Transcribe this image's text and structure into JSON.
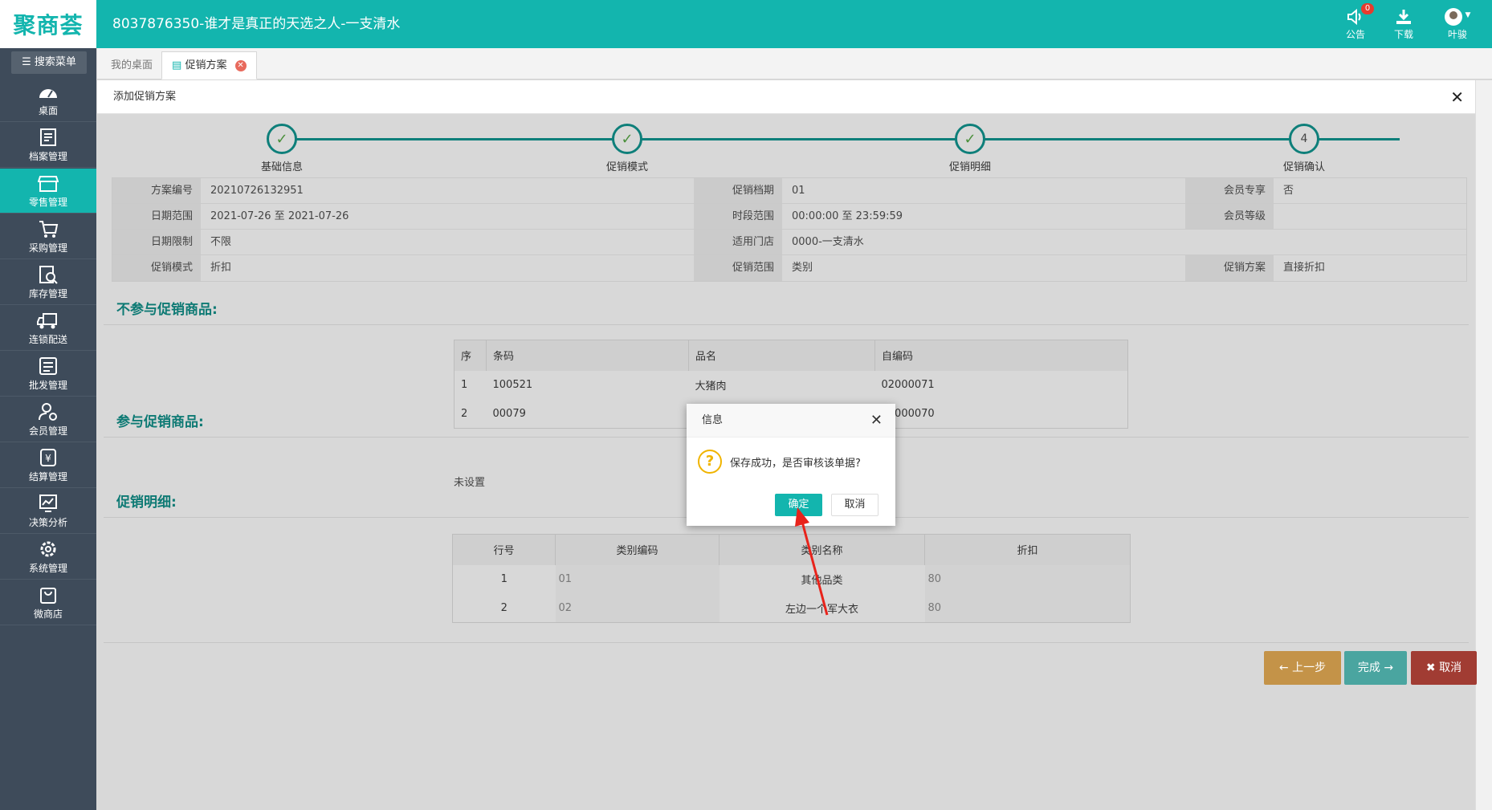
{
  "app": {
    "logo": "聚商荟",
    "title": "8037876350-谁才是真正的天选之人-一支清水",
    "top_tools": {
      "notice_label": "公告",
      "notice_count": "0",
      "download_label": "下载",
      "user_label": "叶骏"
    }
  },
  "sidebar": {
    "search_label": "搜索菜单",
    "items": [
      {
        "label": "桌面",
        "icon": "dashboard-icon"
      },
      {
        "label": "档案管理",
        "icon": "archive-icon"
      },
      {
        "label": "零售管理",
        "icon": "store-icon",
        "active": true
      },
      {
        "label": "采购管理",
        "icon": "purchase-icon"
      },
      {
        "label": "库存管理",
        "icon": "inventory-icon"
      },
      {
        "label": "连锁配送",
        "icon": "truck-icon"
      },
      {
        "label": "批发管理",
        "icon": "wholesale-icon"
      },
      {
        "label": "会员管理",
        "icon": "member-icon"
      },
      {
        "label": "结算管理",
        "icon": "settlement-icon"
      },
      {
        "label": "决策分析",
        "icon": "analysis-icon"
      },
      {
        "label": "系统管理",
        "icon": "gear-icon"
      },
      {
        "label": "微商店",
        "icon": "bag-icon"
      }
    ]
  },
  "tabs": {
    "desktop": "我的桌面",
    "promo": "促销方案"
  },
  "panel": {
    "title": "添加促销方案"
  },
  "steps": [
    "基础信息",
    "促销模式",
    "促销明细",
    "促销确认"
  ],
  "step4_number": "4",
  "info": {
    "r1": {
      "k1": "方案编号",
      "v1": "20210726132951",
      "k2": "促销档期",
      "v2": "01",
      "k3": "会员专享",
      "v3": "否"
    },
    "r2": {
      "k1": "日期范围",
      "v1": "2021-07-26 至 2021-07-26",
      "k2": "时段范围",
      "v2": "00:00:00 至 23:59:59",
      "k3": "会员等级",
      "v3": ""
    },
    "r3": {
      "k1": "日期限制",
      "v1": "不限",
      "k2": "适用门店",
      "v2": "0000-一支清水"
    },
    "r4": {
      "k1": "促销模式",
      "v1": "折扣",
      "k2": "促销范围",
      "v2": "类别",
      "k3": "促销方案",
      "v3": "直接折扣"
    }
  },
  "sections": {
    "excluded": "不参与促销商品:",
    "included": "参与促销商品:",
    "detail": "促销明细:"
  },
  "excluded_table": {
    "headers": [
      "序",
      "条码",
      "品名",
      "自编码"
    ],
    "rows": [
      [
        "1",
        "100521",
        "大猪肉",
        "02000071"
      ],
      [
        "2",
        "00079",
        "",
        "02000070"
      ]
    ]
  },
  "included_text": "未设置",
  "detail_table": {
    "headers": [
      "行号",
      "类别编码",
      "类别名称",
      "折扣"
    ],
    "rows": [
      [
        "1",
        "01",
        "其他品类",
        "80"
      ],
      [
        "2",
        "02",
        "左边一个军大衣",
        "80"
      ]
    ]
  },
  "buttons": {
    "prev": "← 上一步",
    "finish": "完成 →",
    "cancel": "✖ 取消"
  },
  "dialog": {
    "title": "信息",
    "message": "保存成功，是否审核该单据?",
    "ok": "确定",
    "cancel": "取消"
  },
  "colors": {
    "teal": "#13b5ae",
    "sidebar": "#3e4b5a",
    "arrow": "#e8231b"
  }
}
